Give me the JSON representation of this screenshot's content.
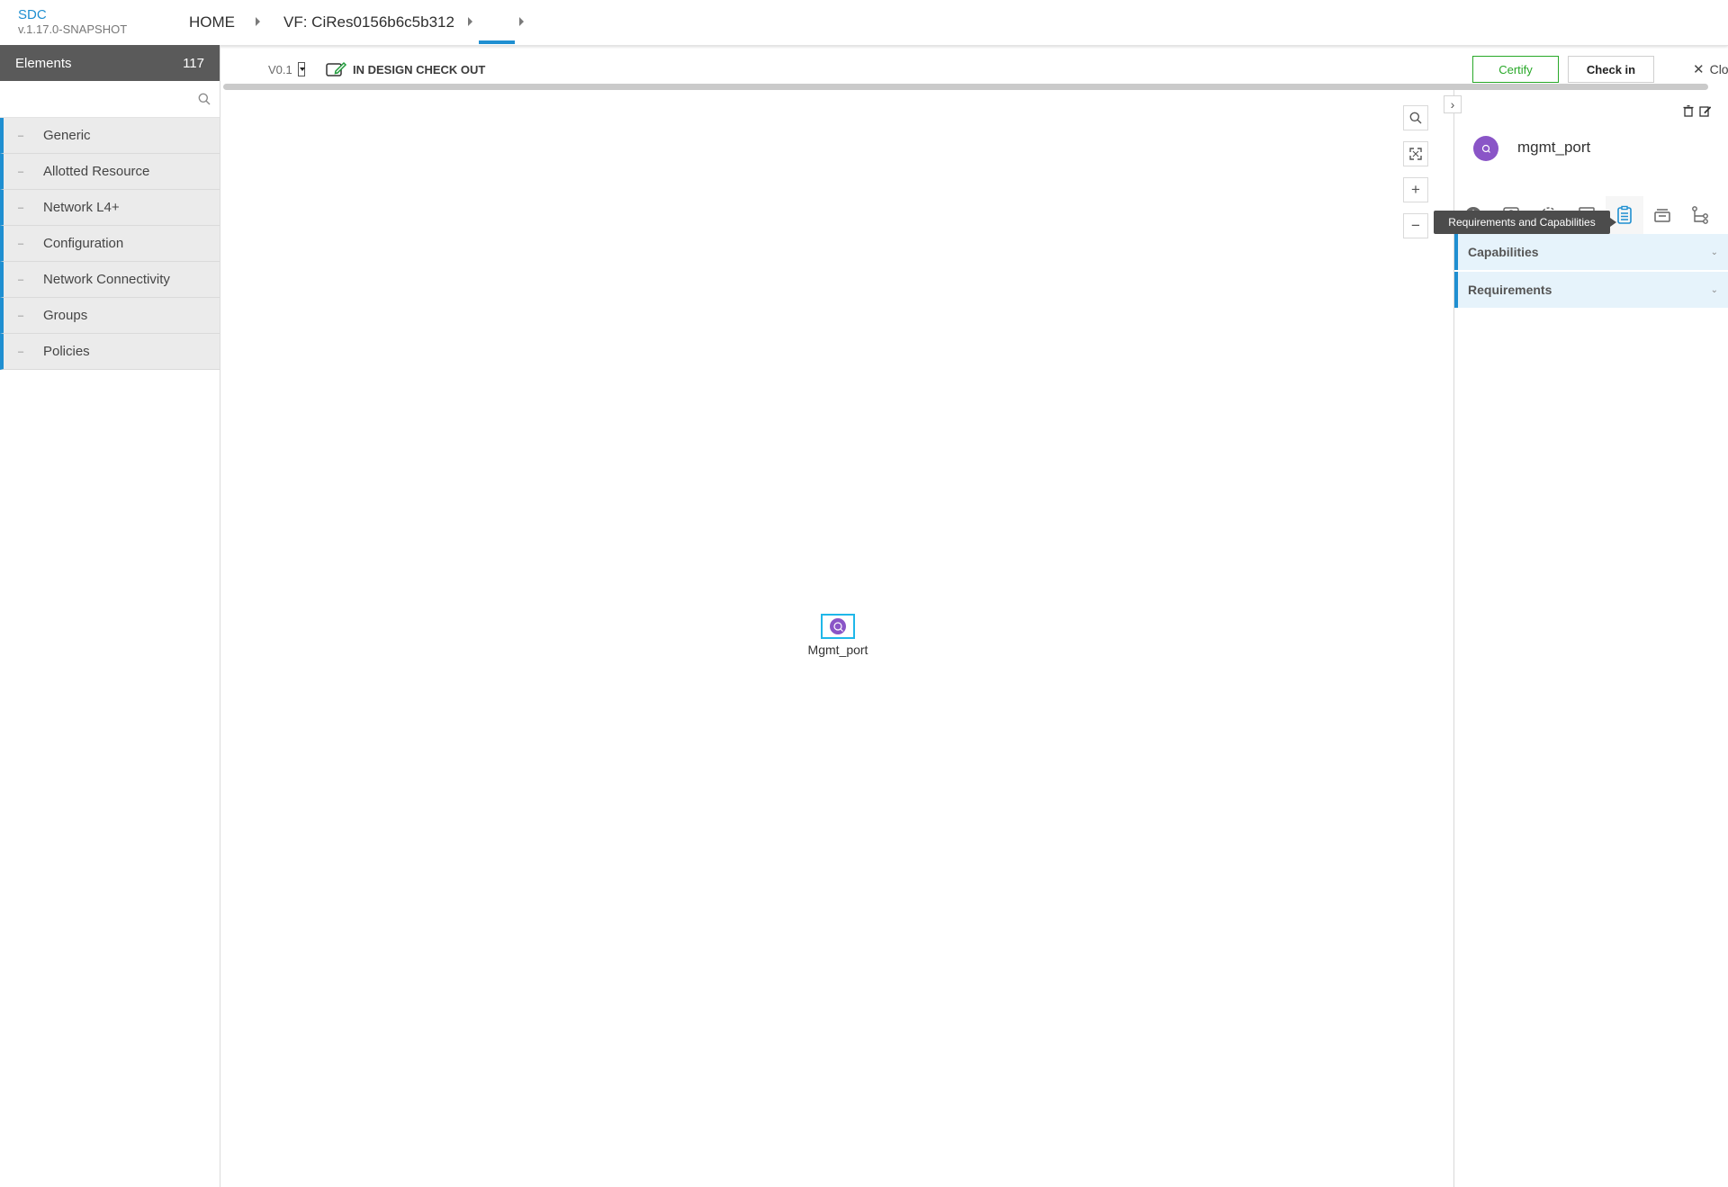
{
  "header": {
    "app_name": "SDC",
    "version": "v.1.17.0-SNAPSHOT",
    "breadcrumbs": [
      "HOME",
      "VF: CiRes0156b6c5b312",
      ""
    ]
  },
  "palette": {
    "title": "Elements",
    "count": "117",
    "search_placeholder": "",
    "groups": [
      {
        "label": "Generic"
      },
      {
        "label": "Allotted Resource"
      },
      {
        "label": "Network L4+"
      },
      {
        "label": "Configuration"
      },
      {
        "label": "Network Connectivity"
      },
      {
        "label": "Groups"
      },
      {
        "label": "Policies"
      }
    ]
  },
  "topbar": {
    "version": "V0.1",
    "status": "IN DESIGN CHECK OUT",
    "certify_label": "Certify",
    "checkin_label": "Check in",
    "close_label": "Clo"
  },
  "canvas": {
    "node_label": "Mgmt_port",
    "zoom_controls": [
      "search-icon",
      "fit-screen-icon",
      "zoom-in-icon",
      "zoom-out-icon"
    ]
  },
  "right_panel": {
    "title": "mgmt_port",
    "active_tab": "Requirements and Capabilities",
    "tooltip": "Requirements and Capabilities",
    "tabs": [
      "info-icon",
      "deployment-artifacts-icon",
      "settings-icon",
      "properties-icon",
      "requirements-capabilities-icon",
      "api-icon",
      "composition-icon"
    ],
    "sections": [
      "Capabilities",
      "Requirements"
    ]
  },
  "colors": {
    "accent": "#1f8fd1",
    "certify_green": "#28a828",
    "node_purple": "#8a55c7",
    "palette_header": "#5a5a5a",
    "section_bg": "#e6f3fb"
  }
}
